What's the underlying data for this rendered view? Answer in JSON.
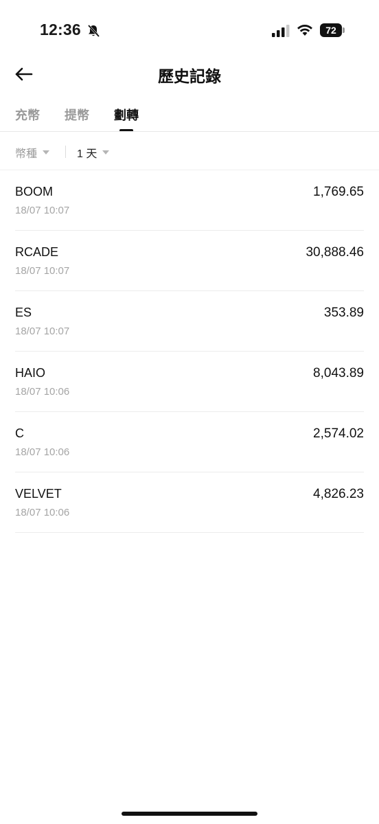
{
  "status_bar": {
    "time": "12:36",
    "battery": "72"
  },
  "header": {
    "title": "歷史記錄"
  },
  "tabs": [
    {
      "label": "充幣",
      "active": false
    },
    {
      "label": "提幣",
      "active": false
    },
    {
      "label": "劃轉",
      "active": true
    }
  ],
  "filters": {
    "currency_label": "幣種",
    "period_label": "1 天"
  },
  "records": [
    {
      "coin": "BOOM",
      "time": "18/07 10:07",
      "amount": "1,769.65"
    },
    {
      "coin": "RCADE",
      "time": "18/07 10:07",
      "amount": "30,888.46"
    },
    {
      "coin": "ES",
      "time": "18/07 10:07",
      "amount": "353.89"
    },
    {
      "coin": "HAIO",
      "time": "18/07 10:06",
      "amount": "8,043.89"
    },
    {
      "coin": "C",
      "time": "18/07 10:06",
      "amount": "2,574.02"
    },
    {
      "coin": "VELVET",
      "time": "18/07 10:06",
      "amount": "4,826.23"
    }
  ]
}
